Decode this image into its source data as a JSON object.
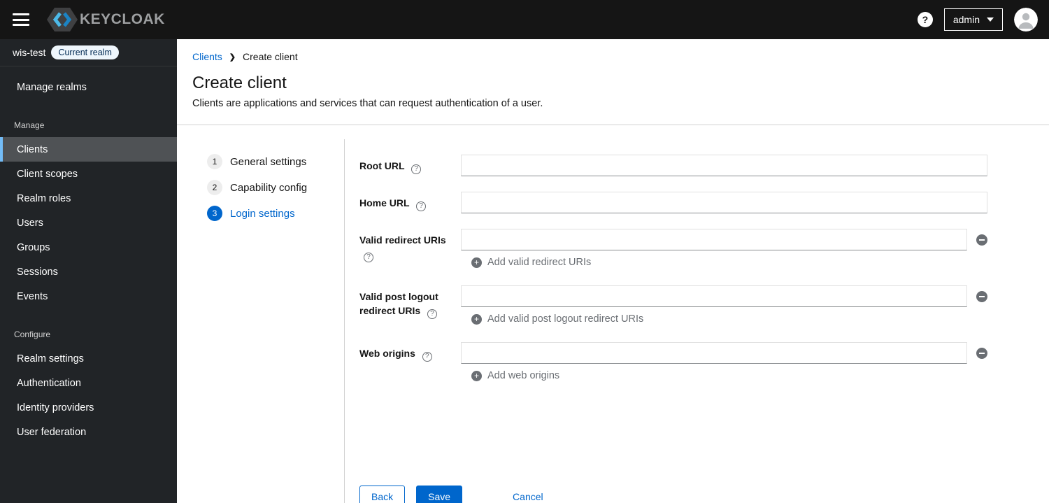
{
  "masthead": {
    "logo_text": "KEYCLOAK",
    "help_icon": "?",
    "user_menu": "admin"
  },
  "sidebar": {
    "realm": {
      "name": "wis-test",
      "badge": "Current realm"
    },
    "manage_realms_label": "Manage realms",
    "sections": [
      {
        "title": "Manage",
        "items": [
          {
            "label": "Clients",
            "active": true
          },
          {
            "label": "Client scopes",
            "active": false
          },
          {
            "label": "Realm roles",
            "active": false
          },
          {
            "label": "Users",
            "active": false
          },
          {
            "label": "Groups",
            "active": false
          },
          {
            "label": "Sessions",
            "active": false
          },
          {
            "label": "Events",
            "active": false
          }
        ]
      },
      {
        "title": "Configure",
        "items": [
          {
            "label": "Realm settings",
            "active": false
          },
          {
            "label": "Authentication",
            "active": false
          },
          {
            "label": "Identity providers",
            "active": false
          },
          {
            "label": "User federation",
            "active": false
          }
        ]
      }
    ]
  },
  "breadcrumb": {
    "link": "Clients",
    "current": "Create client"
  },
  "page": {
    "title": "Create client",
    "subtitle": "Clients are applications and services that can request authentication of a user."
  },
  "wizard": {
    "steps": [
      {
        "num": "1",
        "label": "General settings",
        "active": false
      },
      {
        "num": "2",
        "label": "Capability config",
        "active": false
      },
      {
        "num": "3",
        "label": "Login settings",
        "active": true
      }
    ]
  },
  "form": {
    "fields": [
      {
        "label": "Root URL",
        "value": "",
        "multivalue": false
      },
      {
        "label": "Home URL",
        "value": "",
        "multivalue": false
      },
      {
        "label": "Valid redirect URIs",
        "value": "",
        "multivalue": true,
        "add_label": "Add valid redirect URIs"
      },
      {
        "label": "Valid post logout redirect URIs",
        "value": "",
        "multivalue": true,
        "add_label": "Add valid post logout redirect URIs"
      },
      {
        "label": "Web origins",
        "value": "",
        "multivalue": true,
        "add_label": "Add web origins"
      }
    ],
    "actions": {
      "back": "Back",
      "save": "Save",
      "cancel": "Cancel"
    }
  },
  "colors": {
    "accent": "#0066cc",
    "masthead_bg": "#151515",
    "sidebar_bg": "#212427",
    "selected_item_bg": "#4f5255",
    "selected_item_border": "#73bcf7",
    "muted": "#6a6e73",
    "divider": "#d2d2d2"
  }
}
